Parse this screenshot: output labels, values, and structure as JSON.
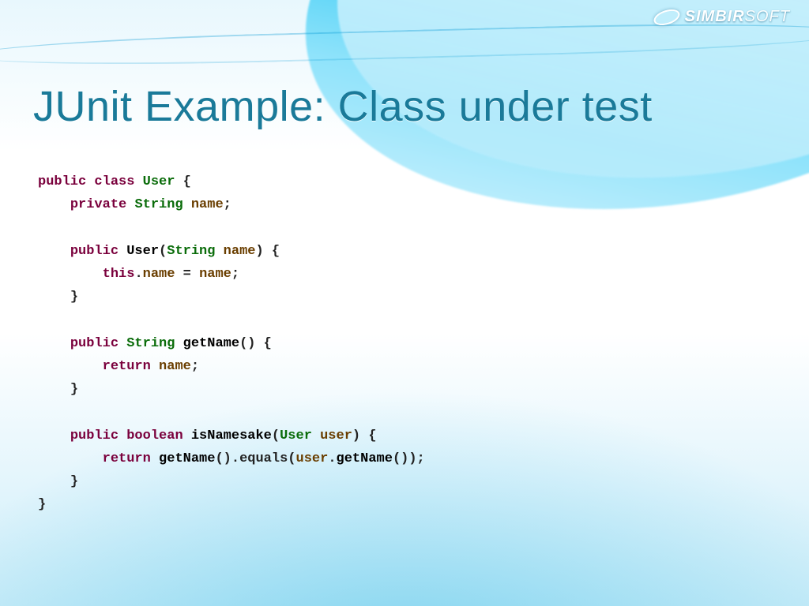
{
  "logo": {
    "brand1": "SIMBIR",
    "brand2": "SOFT"
  },
  "title": "JUnit Example: Class under test",
  "code": {
    "l1": {
      "kw1": "public",
      "kw2": "class",
      "cls": "User",
      "open": " {"
    },
    "l2": {
      "kw": "private",
      "type": "String",
      "field": "name",
      "end": ";"
    },
    "l3": {
      "kw": "public",
      "ctor": "User",
      "lp": "(",
      "ptype": "String",
      "pname": "name",
      "rp": ") {"
    },
    "l4": {
      "kw": "this",
      "dot": ".",
      "field": "name",
      "eq": " = ",
      "rhs": "name",
      "end": ";"
    },
    "l5": {
      "close": "}"
    },
    "l6": {
      "kw": "public",
      "rtype": "String",
      "mname": "getName",
      "sig": "() {"
    },
    "l7": {
      "kw": "return",
      "rhs": "name",
      "end": ";"
    },
    "l8": {
      "close": "}"
    },
    "l9": {
      "kw": "public",
      "rtype": "boolean",
      "mname": "isNamesake",
      "lp": "(",
      "ptype": "User",
      "pname": "user",
      "rp": ") {"
    },
    "l10": {
      "kw": "return",
      "call1": "getName",
      "mid": "().equals(",
      "obj": "user",
      "dot": ".",
      "call2": "getName",
      "tail": "());"
    },
    "l11": {
      "close": "}"
    },
    "l12": {
      "close": "}"
    }
  }
}
